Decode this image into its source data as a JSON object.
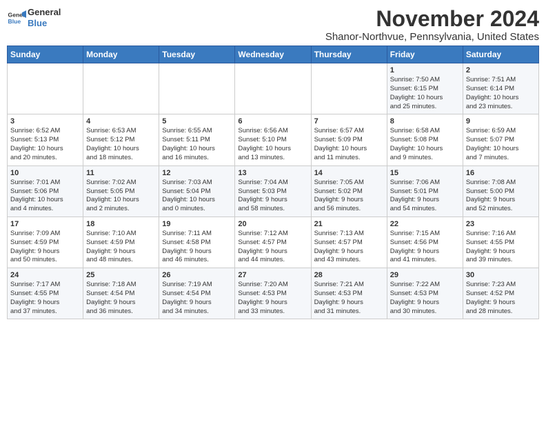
{
  "header": {
    "logo_line1": "General",
    "logo_line2": "Blue",
    "month": "November 2024",
    "location": "Shanor-Northvue, Pennsylvania, United States"
  },
  "weekdays": [
    "Sunday",
    "Monday",
    "Tuesday",
    "Wednesday",
    "Thursday",
    "Friday",
    "Saturday"
  ],
  "weeks": [
    [
      {
        "day": "",
        "info": ""
      },
      {
        "day": "",
        "info": ""
      },
      {
        "day": "",
        "info": ""
      },
      {
        "day": "",
        "info": ""
      },
      {
        "day": "",
        "info": ""
      },
      {
        "day": "1",
        "info": "Sunrise: 7:50 AM\nSunset: 6:15 PM\nDaylight: 10 hours\nand 25 minutes."
      },
      {
        "day": "2",
        "info": "Sunrise: 7:51 AM\nSunset: 6:14 PM\nDaylight: 10 hours\nand 23 minutes."
      }
    ],
    [
      {
        "day": "3",
        "info": "Sunrise: 6:52 AM\nSunset: 5:13 PM\nDaylight: 10 hours\nand 20 minutes."
      },
      {
        "day": "4",
        "info": "Sunrise: 6:53 AM\nSunset: 5:12 PM\nDaylight: 10 hours\nand 18 minutes."
      },
      {
        "day": "5",
        "info": "Sunrise: 6:55 AM\nSunset: 5:11 PM\nDaylight: 10 hours\nand 16 minutes."
      },
      {
        "day": "6",
        "info": "Sunrise: 6:56 AM\nSunset: 5:10 PM\nDaylight: 10 hours\nand 13 minutes."
      },
      {
        "day": "7",
        "info": "Sunrise: 6:57 AM\nSunset: 5:09 PM\nDaylight: 10 hours\nand 11 minutes."
      },
      {
        "day": "8",
        "info": "Sunrise: 6:58 AM\nSunset: 5:08 PM\nDaylight: 10 hours\nand 9 minutes."
      },
      {
        "day": "9",
        "info": "Sunrise: 6:59 AM\nSunset: 5:07 PM\nDaylight: 10 hours\nand 7 minutes."
      }
    ],
    [
      {
        "day": "10",
        "info": "Sunrise: 7:01 AM\nSunset: 5:06 PM\nDaylight: 10 hours\nand 4 minutes."
      },
      {
        "day": "11",
        "info": "Sunrise: 7:02 AM\nSunset: 5:05 PM\nDaylight: 10 hours\nand 2 minutes."
      },
      {
        "day": "12",
        "info": "Sunrise: 7:03 AM\nSunset: 5:04 PM\nDaylight: 10 hours\nand 0 minutes."
      },
      {
        "day": "13",
        "info": "Sunrise: 7:04 AM\nSunset: 5:03 PM\nDaylight: 9 hours\nand 58 minutes."
      },
      {
        "day": "14",
        "info": "Sunrise: 7:05 AM\nSunset: 5:02 PM\nDaylight: 9 hours\nand 56 minutes."
      },
      {
        "day": "15",
        "info": "Sunrise: 7:06 AM\nSunset: 5:01 PM\nDaylight: 9 hours\nand 54 minutes."
      },
      {
        "day": "16",
        "info": "Sunrise: 7:08 AM\nSunset: 5:00 PM\nDaylight: 9 hours\nand 52 minutes."
      }
    ],
    [
      {
        "day": "17",
        "info": "Sunrise: 7:09 AM\nSunset: 4:59 PM\nDaylight: 9 hours\nand 50 minutes."
      },
      {
        "day": "18",
        "info": "Sunrise: 7:10 AM\nSunset: 4:59 PM\nDaylight: 9 hours\nand 48 minutes."
      },
      {
        "day": "19",
        "info": "Sunrise: 7:11 AM\nSunset: 4:58 PM\nDaylight: 9 hours\nand 46 minutes."
      },
      {
        "day": "20",
        "info": "Sunrise: 7:12 AM\nSunset: 4:57 PM\nDaylight: 9 hours\nand 44 minutes."
      },
      {
        "day": "21",
        "info": "Sunrise: 7:13 AM\nSunset: 4:57 PM\nDaylight: 9 hours\nand 43 minutes."
      },
      {
        "day": "22",
        "info": "Sunrise: 7:15 AM\nSunset: 4:56 PM\nDaylight: 9 hours\nand 41 minutes."
      },
      {
        "day": "23",
        "info": "Sunrise: 7:16 AM\nSunset: 4:55 PM\nDaylight: 9 hours\nand 39 minutes."
      }
    ],
    [
      {
        "day": "24",
        "info": "Sunrise: 7:17 AM\nSunset: 4:55 PM\nDaylight: 9 hours\nand 37 minutes."
      },
      {
        "day": "25",
        "info": "Sunrise: 7:18 AM\nSunset: 4:54 PM\nDaylight: 9 hours\nand 36 minutes."
      },
      {
        "day": "26",
        "info": "Sunrise: 7:19 AM\nSunset: 4:54 PM\nDaylight: 9 hours\nand 34 minutes."
      },
      {
        "day": "27",
        "info": "Sunrise: 7:20 AM\nSunset: 4:53 PM\nDaylight: 9 hours\nand 33 minutes."
      },
      {
        "day": "28",
        "info": "Sunrise: 7:21 AM\nSunset: 4:53 PM\nDaylight: 9 hours\nand 31 minutes."
      },
      {
        "day": "29",
        "info": "Sunrise: 7:22 AM\nSunset: 4:53 PM\nDaylight: 9 hours\nand 30 minutes."
      },
      {
        "day": "30",
        "info": "Sunrise: 7:23 AM\nSunset: 4:52 PM\nDaylight: 9 hours\nand 28 minutes."
      }
    ]
  ]
}
